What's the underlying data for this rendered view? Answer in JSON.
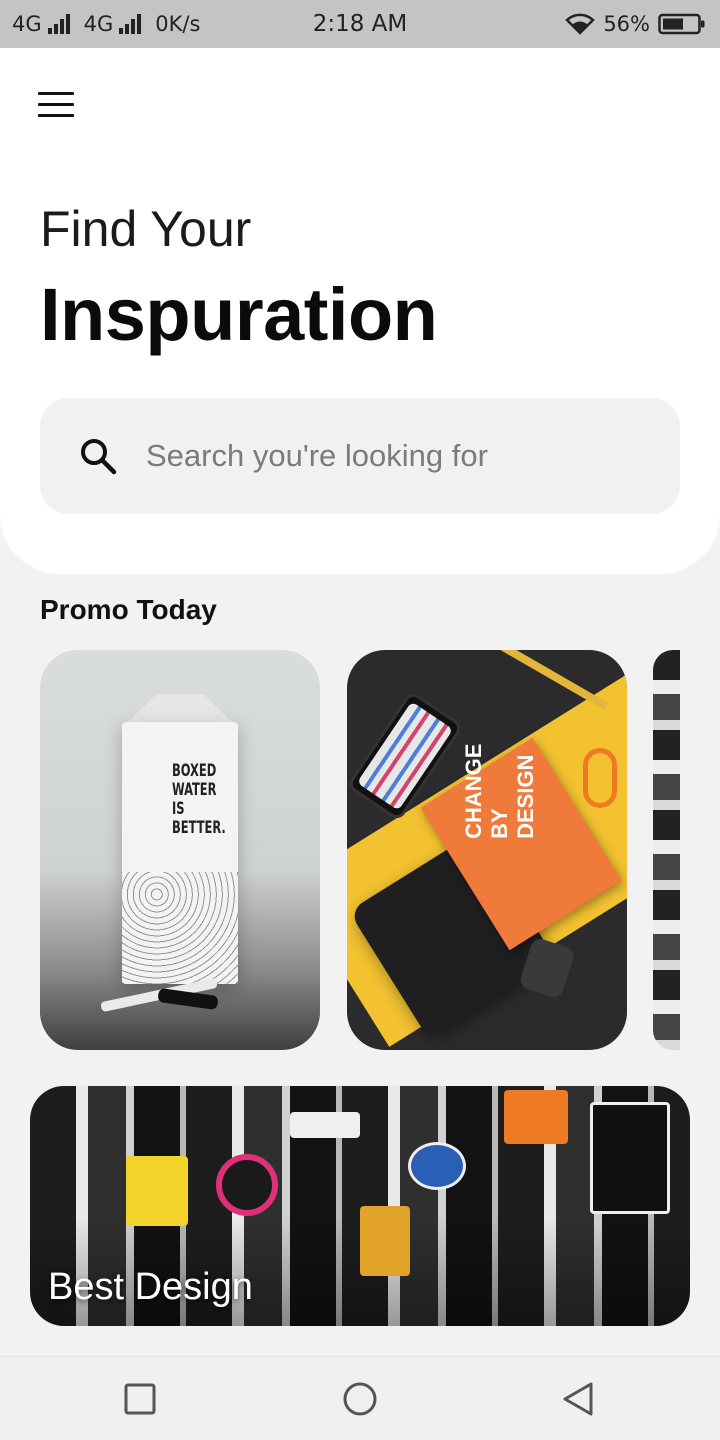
{
  "status_bar": {
    "network_left": "4G",
    "network_right": "4G",
    "speed": "0K/s",
    "time": "2:18 AM",
    "battery": "56%"
  },
  "header": {
    "title_line1": "Find Your",
    "title_line2": "Inspuration"
  },
  "search": {
    "placeholder": "Search you're looking for",
    "value": ""
  },
  "promo": {
    "section_title": "Promo Today",
    "cards": [
      {
        "carton_text": "BOXED WATER IS BETTER."
      },
      {
        "book_text": "CHANGE BY DESIGN"
      },
      {}
    ]
  },
  "banner": {
    "label": "Best Design"
  },
  "navigation": {
    "items": [
      "recent-apps",
      "home",
      "back"
    ]
  },
  "colors": {
    "status_bar_bg": "#c4c4c4",
    "card_bg": "#ffffff",
    "page_bg": "#f2f2f2",
    "search_bg": "#f1f1f1",
    "accent_orange": "#f07a3a",
    "accent_yellow": "#f2c230"
  }
}
